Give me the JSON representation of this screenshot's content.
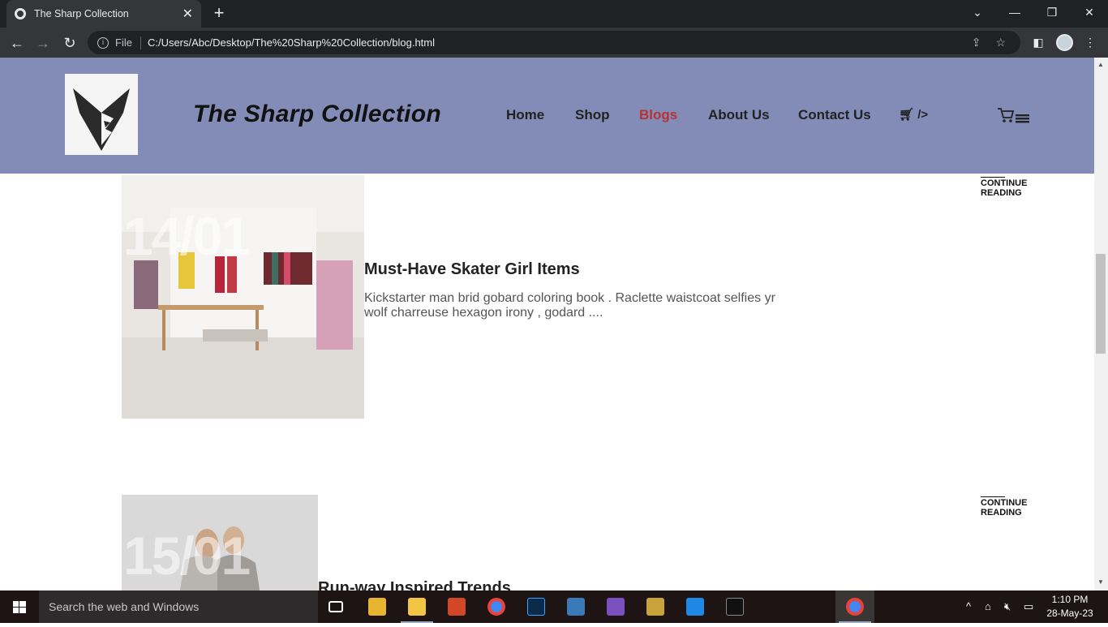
{
  "browser": {
    "tab_title": "The Sharp Collection",
    "tab_close": "✕",
    "new_tab": "+",
    "address_file_label": "File",
    "url": "C:/Users/Abc/Desktop/The%20Sharp%20Collection/blog.html"
  },
  "site": {
    "title": "The Sharp Collection",
    "nav": [
      {
        "label": "Home"
      },
      {
        "label": "Shop"
      },
      {
        "label": "Blogs"
      },
      {
        "label": "About Us"
      },
      {
        "label": "Contact Us"
      }
    ],
    "cart_text": "/>"
  },
  "posts": [
    {
      "date": "14/01",
      "title": "Must-Have Skater Girl Items",
      "excerpt": "Kickstarter man brid gobard coloring book . Raclette waistcoat selfies yr wolf charreuse hexagon irony , godard ....",
      "continue": "CONTINUE READING"
    },
    {
      "date": "15/01",
      "title": "Run-way Inspired Trends",
      "continue": "CONTINUE READING"
    }
  ],
  "taskbar": {
    "search_placeholder": "Search the web and Windows",
    "time": "1:10 PM",
    "date": "28-May-23"
  },
  "colors": {
    "header_bg": "#838cb6",
    "active_nav": "#b83236"
  }
}
